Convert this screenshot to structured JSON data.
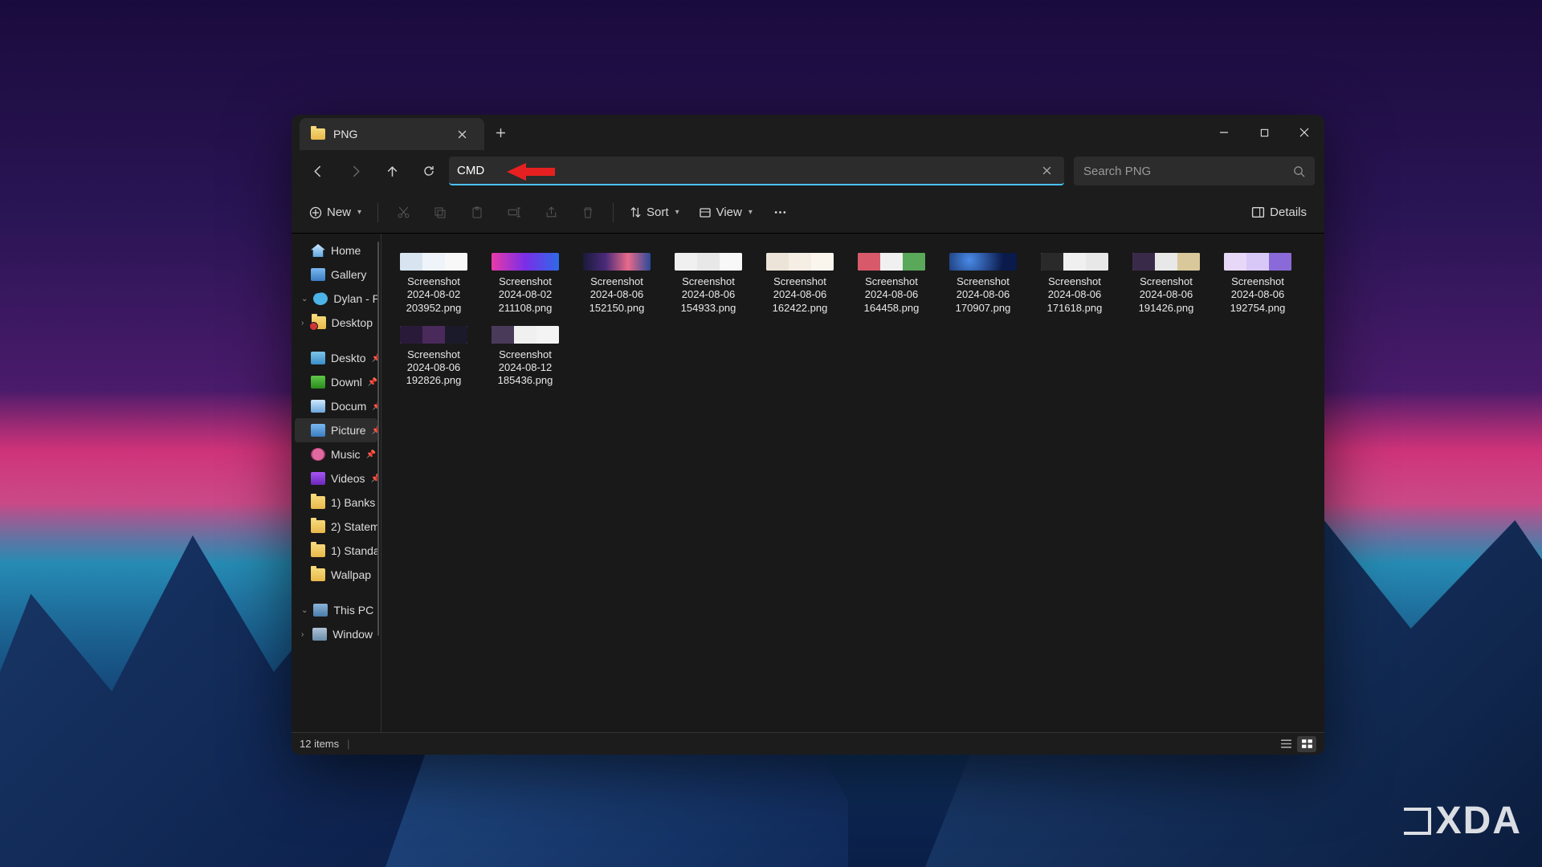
{
  "titlebar": {
    "tab_title": "PNG"
  },
  "nav": {
    "address_value": "CMD",
    "search_placeholder": "Search PNG"
  },
  "toolbar": {
    "new": "New",
    "sort": "Sort",
    "view": "View",
    "details": "Details"
  },
  "sidebar": {
    "home": "Home",
    "gallery": "Gallery",
    "user": "Dylan - Pe",
    "desktop": "Desktop",
    "qa": [
      {
        "k": "desktop",
        "l": "Deskto"
      },
      {
        "k": "dl",
        "l": "Downl"
      },
      {
        "k": "doc",
        "l": "Docum"
      },
      {
        "k": "pic",
        "l": "Picture"
      },
      {
        "k": "music",
        "l": "Music"
      },
      {
        "k": "video",
        "l": "Videos"
      }
    ],
    "folders": [
      "1) Banks",
      "2) Statem",
      "1) Standa",
      "Wallpap"
    ],
    "thispc": "This PC",
    "drive": "Window"
  },
  "files": [
    {
      "name": "Screenshot 2024-08-02 203952.png",
      "t": "t1"
    },
    {
      "name": "Screenshot 2024-08-02 211108.png",
      "t": "t2"
    },
    {
      "name": "Screenshot 2024-08-06 152150.png",
      "t": "t3"
    },
    {
      "name": "Screenshot 2024-08-06 154933.png",
      "t": "t4"
    },
    {
      "name": "Screenshot 2024-08-06 162422.png",
      "t": "t5"
    },
    {
      "name": "Screenshot 2024-08-06 164458.png",
      "t": "t6"
    },
    {
      "name": "Screenshot 2024-08-06 170907.png",
      "t": "t7"
    },
    {
      "name": "Screenshot 2024-08-06 171618.png",
      "t": "t8"
    },
    {
      "name": "Screenshot 2024-08-06 191426.png",
      "t": "t9"
    },
    {
      "name": "Screenshot 2024-08-06 192754.png",
      "t": "t10"
    },
    {
      "name": "Screenshot 2024-08-06 192826.png",
      "t": "t11"
    },
    {
      "name": "Screenshot 2024-08-12 185436.png",
      "t": "t12"
    }
  ],
  "status": {
    "count": "12 items"
  },
  "watermark": "XDA"
}
